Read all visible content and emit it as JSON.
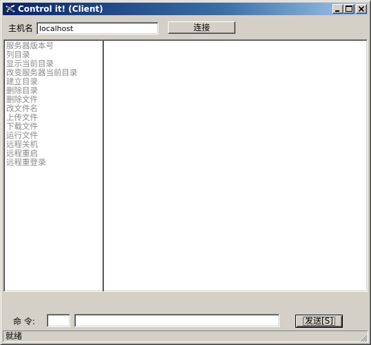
{
  "window": {
    "title": "Control it! (Client)",
    "icons": {
      "app": "app-logo-icon",
      "minimize": "minimize-icon",
      "maximize": "maximize-icon",
      "close": "close-icon"
    }
  },
  "host": {
    "label": "主机名",
    "value": "localhost",
    "connect_label": "连接"
  },
  "commands": [
    "服务器版本号",
    "列目录",
    "显示当前目录",
    "改变服务器当前目录",
    "建立目录",
    "删除目录",
    "删除文件",
    "改文件名",
    "上传文件",
    "下载文件",
    "运行文件",
    "远程关机",
    "远程重启",
    "远程重登录"
  ],
  "command_bar": {
    "label": "命 令:",
    "code_value": "",
    "args_value": "",
    "send_label": "发送[S]"
  },
  "status": {
    "text": "就绪"
  },
  "colors": {
    "title_start": "#0a246a",
    "title_end": "#a6caf0",
    "face": "#d4d0c8",
    "disabled_text": "#8a8a8a"
  }
}
